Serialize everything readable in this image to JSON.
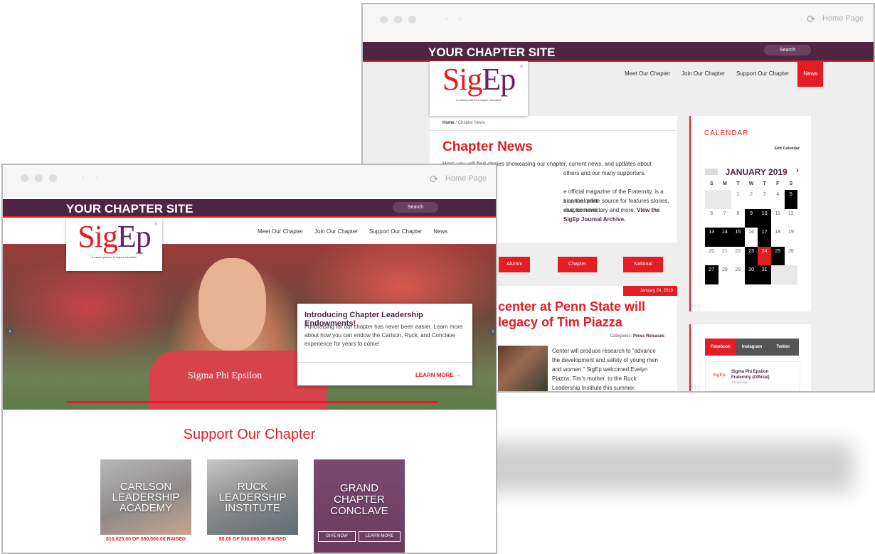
{
  "browser": {
    "address": "Home Page"
  },
  "site": {
    "title": "YOUR CHAPTER SITE",
    "search": "Search"
  },
  "logo": {
    "sig": "Sig",
    "ep": "Ep",
    "tagline": "A valued partner in higher education",
    "reg": "®"
  },
  "nav": {
    "items": [
      "Meet Our Chapter",
      "Join Our Chapter",
      "Support Our Chapter",
      "News"
    ],
    "active": "News"
  },
  "news_page": {
    "breadcrumb_home": "Home",
    "breadcrumb_current": "/ Chapter News",
    "heading": "Chapter News",
    "intro_1": "Here you will find stories showcasing our chapter, current news, and updates about",
    "intro_2": "others and our many supporters.",
    "intro_3": "e official magazine of the Fraternity, is a biannual print",
    "intro_4": "s as the online source for features stories, chapter news,",
    "intro_5": "ews, commentary and more.",
    "intro_link": "View the SigEp Journal Archive.",
    "filters": [
      "Alumni",
      "Chapter",
      "National"
    ],
    "article": {
      "date": "January 24, 2019",
      "title_1": "center at Penn State will",
      "title_2": "legacy of Tim Piazza",
      "categories_label": "Categories:",
      "category": "Press Releases",
      "body": [
        "Center will produce research to “advance",
        "the development and safety of young men",
        "and women.” SigEp welcomed Evelyn",
        "Piazza, Tim’s mother, to the Ruck",
        "Leadership Institute this summer."
      ]
    }
  },
  "calendar": {
    "title": "CALENDAR",
    "edit": "Edit Calendar",
    "month": "JANUARY 2019",
    "next": "›",
    "dow": [
      "S",
      "M",
      "T",
      "W",
      "T",
      "F",
      "S"
    ],
    "weeks": [
      [
        "",
        "",
        "1",
        "2",
        "3",
        "4",
        "5"
      ],
      [
        "6",
        "7",
        "8",
        "9",
        "10",
        "11",
        "12"
      ],
      [
        "13",
        "14",
        "15",
        "16",
        "17",
        "18",
        "19"
      ],
      [
        "20",
        "21",
        "22",
        "23",
        "24",
        "25",
        "26"
      ],
      [
        "27",
        "28",
        "29",
        "30",
        "31",
        "",
        ""
      ]
    ],
    "event_days": [
      "5",
      "9",
      "10",
      "13",
      "14",
      "15",
      "17",
      "23",
      "25",
      "27",
      "30",
      "31"
    ],
    "today": "24"
  },
  "social": {
    "tabs": [
      "Facebook",
      "Instagram",
      "Twitter"
    ],
    "active": "Facebook",
    "post_name_1": "Sigma Phi Epsilon",
    "post_name_2": "Fraternity (Official)",
    "post_time": "2 hours ago",
    "avatar": "SigEp"
  },
  "home_page": {
    "hero": {
      "shirt_text": "Sigma Phi Epsilon",
      "callout_title": "Introducing Chapter Leadership Endowments!",
      "callout_body_1": "Fundraising for our chapter has never been easier. Learn more",
      "callout_body_2": "about how you can endow the Carlson, Ruck, and Conclave",
      "callout_body_3": "experience for years to come!",
      "cta": "LEARN MORE",
      "prev": "‹",
      "next": "›"
    },
    "support_heading": "Support Our Chapter",
    "tiles": [
      {
        "l1": "CARLSON",
        "l2": "LEADERSHIP",
        "l3": "ACADEMY",
        "caption": "$10,025.00 OF $50,000.00 RAISED"
      },
      {
        "l1": "RUCK",
        "l2": "LEADERSHIP",
        "l3": "INSTITUTE",
        "caption": "$0.00 OF $30,000.00 RAISED"
      },
      {
        "l1": "GRAND",
        "l2": "CHAPTER",
        "l3": "CONCLAVE",
        "give": "GIVE NOW",
        "learn": "LEARN MORE"
      }
    ]
  },
  "colors": {
    "brand_purple": "#4f2541",
    "brand_red": "#e41c23"
  }
}
